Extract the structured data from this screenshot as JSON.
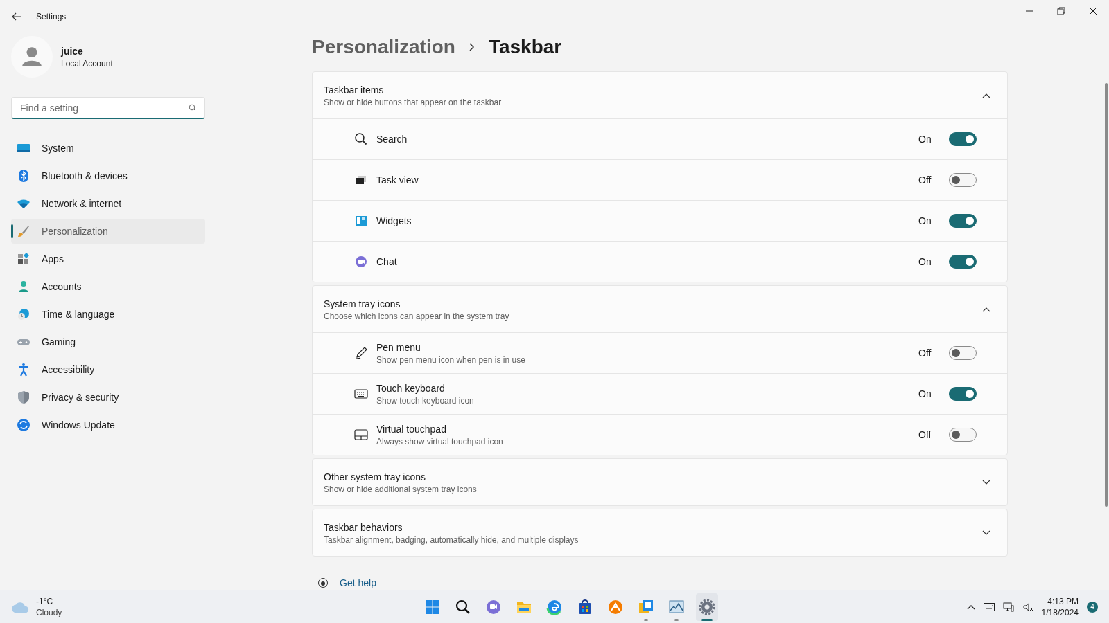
{
  "window": {
    "title": "Settings"
  },
  "account": {
    "name": "juice",
    "type": "Local Account"
  },
  "search": {
    "placeholder": "Find a setting"
  },
  "nav": [
    {
      "label": "System",
      "selected": false
    },
    {
      "label": "Bluetooth & devices",
      "selected": false
    },
    {
      "label": "Network & internet",
      "selected": false
    },
    {
      "label": "Personalization",
      "selected": true
    },
    {
      "label": "Apps",
      "selected": false
    },
    {
      "label": "Accounts",
      "selected": false
    },
    {
      "label": "Time & language",
      "selected": false
    },
    {
      "label": "Gaming",
      "selected": false
    },
    {
      "label": "Accessibility",
      "selected": false
    },
    {
      "label": "Privacy & security",
      "selected": false
    },
    {
      "label": "Windows Update",
      "selected": false
    }
  ],
  "breadcrumb": [
    "Personalization",
    "Taskbar"
  ],
  "sections": [
    {
      "title": "Taskbar items",
      "subtitle": "Show or hide buttons that appear on the taskbar",
      "expanded": true,
      "rows": [
        {
          "label": "Search",
          "on": true,
          "state_label": "On"
        },
        {
          "label": "Task view",
          "on": false,
          "state_label": "Off"
        },
        {
          "label": "Widgets",
          "on": true,
          "state_label": "On"
        },
        {
          "label": "Chat",
          "on": true,
          "state_label": "On"
        }
      ]
    },
    {
      "title": "System tray icons",
      "subtitle": "Choose which icons can appear in the system tray",
      "expanded": true,
      "rows": [
        {
          "label": "Pen menu",
          "description": "Show pen menu icon when pen is in use",
          "on": false,
          "state_label": "Off"
        },
        {
          "label": "Touch keyboard",
          "description": "Show touch keyboard icon",
          "on": true,
          "state_label": "On"
        },
        {
          "label": "Virtual touchpad",
          "description": "Always show virtual touchpad icon",
          "on": false,
          "state_label": "Off"
        }
      ]
    },
    {
      "title": "Other system tray icons",
      "subtitle": "Show or hide additional system tray icons",
      "expanded": false
    },
    {
      "title": "Taskbar behaviors",
      "subtitle": "Taskbar alignment, badging, automatically hide, and multiple displays",
      "expanded": false
    }
  ],
  "get_help": "Get help",
  "taskbar": {
    "weather": {
      "temp": "-1°C",
      "condition": "Cloudy"
    },
    "apps": [
      {
        "running": false,
        "selected": false
      },
      {
        "running": false,
        "selected": false
      },
      {
        "running": false,
        "selected": false
      },
      {
        "running": false,
        "selected": false
      },
      {
        "running": false,
        "selected": false
      },
      {
        "running": false,
        "selected": false
      },
      {
        "running": false,
        "selected": false
      },
      {
        "running": true,
        "selected": false
      },
      {
        "running": true,
        "selected": false
      },
      {
        "running": true,
        "selected": true
      }
    ],
    "time": "4:13 PM",
    "date": "1/18/2024",
    "notifications": "4"
  }
}
